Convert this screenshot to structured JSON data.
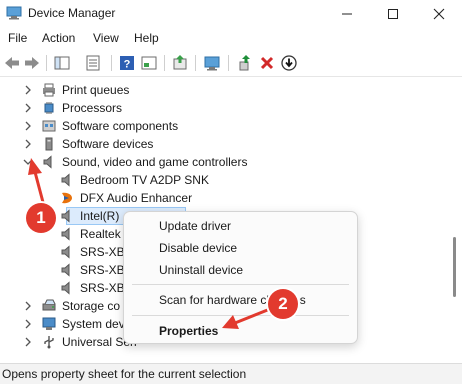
{
  "window": {
    "title": "Device Manager"
  },
  "menu": [
    "File",
    "Action",
    "View",
    "Help"
  ],
  "tree": {
    "items": [
      {
        "label": "Print queues",
        "expanded": false
      },
      {
        "label": "Processors",
        "expanded": false
      },
      {
        "label": "Software components",
        "expanded": false
      },
      {
        "label": "Software devices",
        "expanded": false
      },
      {
        "label": "Sound, video and game controllers",
        "expanded": true
      },
      {
        "label": "Bedroom TV A2DP SNK"
      },
      {
        "label": "DFX Audio Enhancer"
      },
      {
        "label": "Intel(R)",
        "selected": true
      },
      {
        "label": "Realtek"
      },
      {
        "label": "SRS-XB"
      },
      {
        "label": "SRS-XB"
      },
      {
        "label": "SRS-XB"
      },
      {
        "label": "Storage co",
        "expanded": false
      },
      {
        "label": "System dev",
        "expanded": false
      },
      {
        "label": "Universal Seri",
        "expanded": false
      }
    ]
  },
  "context_menu": {
    "items": [
      "Update driver",
      "Disable device",
      "Uninstall device",
      "Scan for hardware changes",
      "Properties"
    ],
    "bold_item": "Properties"
  },
  "annotations": {
    "badge1": "1",
    "badge2": "2",
    "color": "#e23a2e"
  },
  "status": {
    "text": "Opens property sheet for the current selection"
  }
}
